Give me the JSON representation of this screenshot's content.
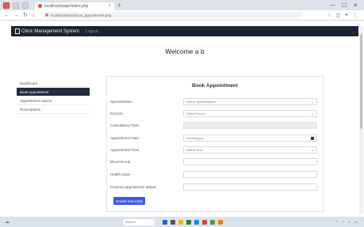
{
  "browser": {
    "tab_title": "localhost/page/index.php",
    "tab_close": "×",
    "new_tab": "+",
    "url": "localhost/clinic/book_appointment.php",
    "nav_icons": [
      "back-icon",
      "forward-icon",
      "reload-icon",
      "home-icon"
    ]
  },
  "app": {
    "brand": "Clinic Management System",
    "nav_link": "Logout",
    "welcome": "Welcome a b"
  },
  "sidebar": {
    "items": [
      {
        "label": "Dashboard"
      },
      {
        "label": "Book Appointment"
      },
      {
        "label": "Appointment History"
      },
      {
        "label": "Prescriptions"
      }
    ]
  },
  "form": {
    "title": "Book Appointment",
    "fields": [
      {
        "label": "Specialization",
        "value": "Select Specialization"
      },
      {
        "label": "Doctors",
        "value": "Select Doctor"
      },
      {
        "label": "Consultancy Fees",
        "value": ""
      },
      {
        "label": "Appointment Date",
        "value": "mm/dd/yyyy"
      },
      {
        "label": "Appointment Time",
        "value": "Select Time"
      },
      {
        "label": "Blood Group",
        "value": ""
      },
      {
        "label": "Health Issue",
        "value": ""
      },
      {
        "label": "Previous appointment details",
        "value": ""
      }
    ],
    "submit_label": "Create new entry"
  },
  "taskbar": {
    "search_placeholder": "Search"
  },
  "colors": {
    "navbar": "#1d2333",
    "sidebar_active": "#232a3c",
    "button": "#3b5bdb"
  }
}
